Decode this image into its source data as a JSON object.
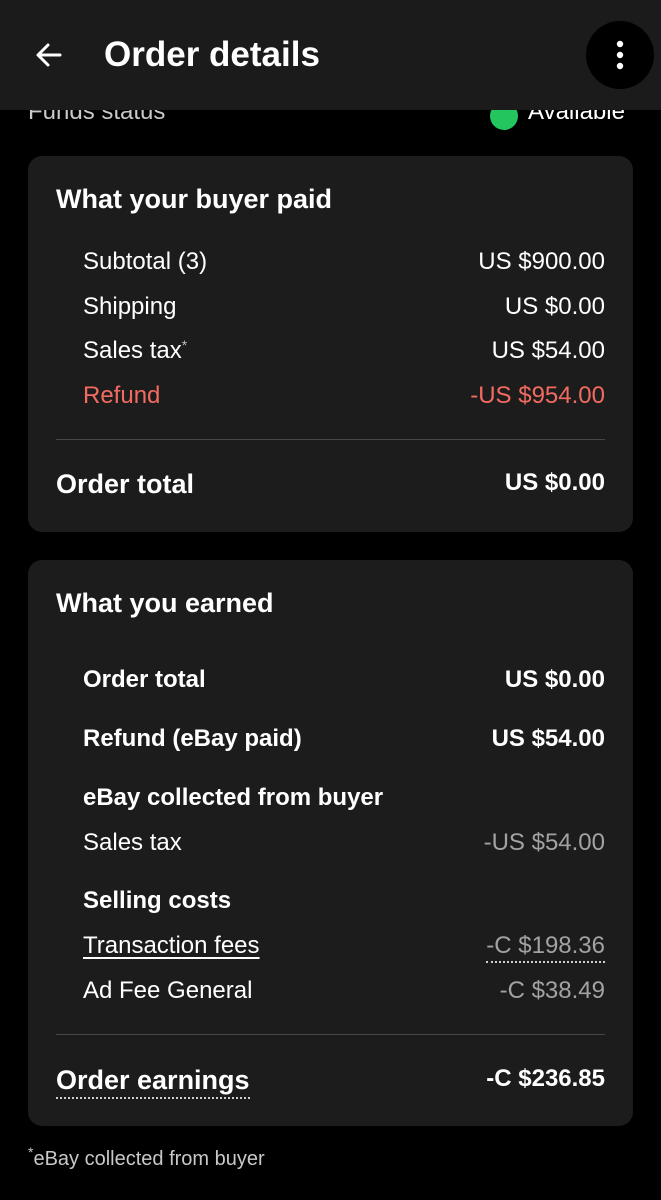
{
  "header": {
    "title": "Order details",
    "back_icon": "arrow-left-icon",
    "more_icon": "more-vertical-icon"
  },
  "funds_status": {
    "label": "Funds status",
    "value": "Available",
    "dot_color": "#22c55e"
  },
  "buyer_paid": {
    "title": "What your buyer paid",
    "rows": [
      {
        "label": "Subtotal (3)",
        "value": "US $900.00"
      },
      {
        "label": "Shipping",
        "value": "US $0.00"
      },
      {
        "label": "Sales tax",
        "asterisk": "*",
        "value": "US $54.00"
      },
      {
        "label": "Refund",
        "value": "-US $954.00"
      }
    ],
    "total_label": "Order total",
    "total_value": "US $0.00",
    "refund_color": "#f36b60"
  },
  "earned": {
    "title": "What you earned",
    "order_total_label": "Order total",
    "order_total_value": "US $0.00",
    "refund_label": "Refund (eBay paid)",
    "refund_value": "US $54.00",
    "collected_heading": "eBay collected from buyer",
    "sales_tax_label": "Sales tax",
    "sales_tax_value": "-US $54.00",
    "selling_costs_heading": "Selling costs",
    "transaction_fees_label": "Transaction fees",
    "transaction_fees_value": "-C $198.36",
    "ad_fee_label": "Ad Fee General",
    "ad_fee_value": "-C $38.49",
    "earnings_label": "Order earnings",
    "earnings_value": "-C $236.85"
  },
  "footnote": {
    "asterisk": "*",
    "text": "eBay collected from buyer"
  }
}
